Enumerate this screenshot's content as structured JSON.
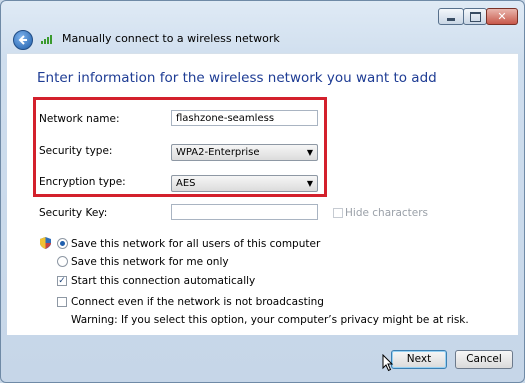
{
  "window": {
    "title": "Manually connect to a wireless network",
    "controls": {
      "minimize": "minimize",
      "maximize": "maximize",
      "close": "✕"
    }
  },
  "page": {
    "heading": "Enter information for the wireless network you want to add"
  },
  "form": {
    "network_name": {
      "label": "Network name:",
      "value": "flashzone-seamless"
    },
    "security_type": {
      "label": "Security type:",
      "value": "WPA2-Enterprise"
    },
    "encryption_type": {
      "label": "Encryption type:",
      "value": "AES"
    },
    "security_key": {
      "label": "Security Key:",
      "value": ""
    },
    "hide_characters": {
      "label": "Hide characters",
      "checked": false,
      "enabled": false
    }
  },
  "options": {
    "save_all_users": {
      "label": "Save this network for all users of this computer",
      "selected": true
    },
    "save_me_only": {
      "label": "Save this network for me only",
      "selected": false
    },
    "start_auto": {
      "label": "Start this connection automatically",
      "checked": true
    },
    "connect_not_broadcasting": {
      "label": "Connect even if the network is not broadcasting",
      "checked": false
    },
    "warning": "Warning: If you select this option, your computer’s privacy might be at risk."
  },
  "buttons": {
    "next": "Next",
    "cancel": "Cancel"
  },
  "colors": {
    "heading": "#1e3c94",
    "highlight_box": "#d3202c"
  }
}
